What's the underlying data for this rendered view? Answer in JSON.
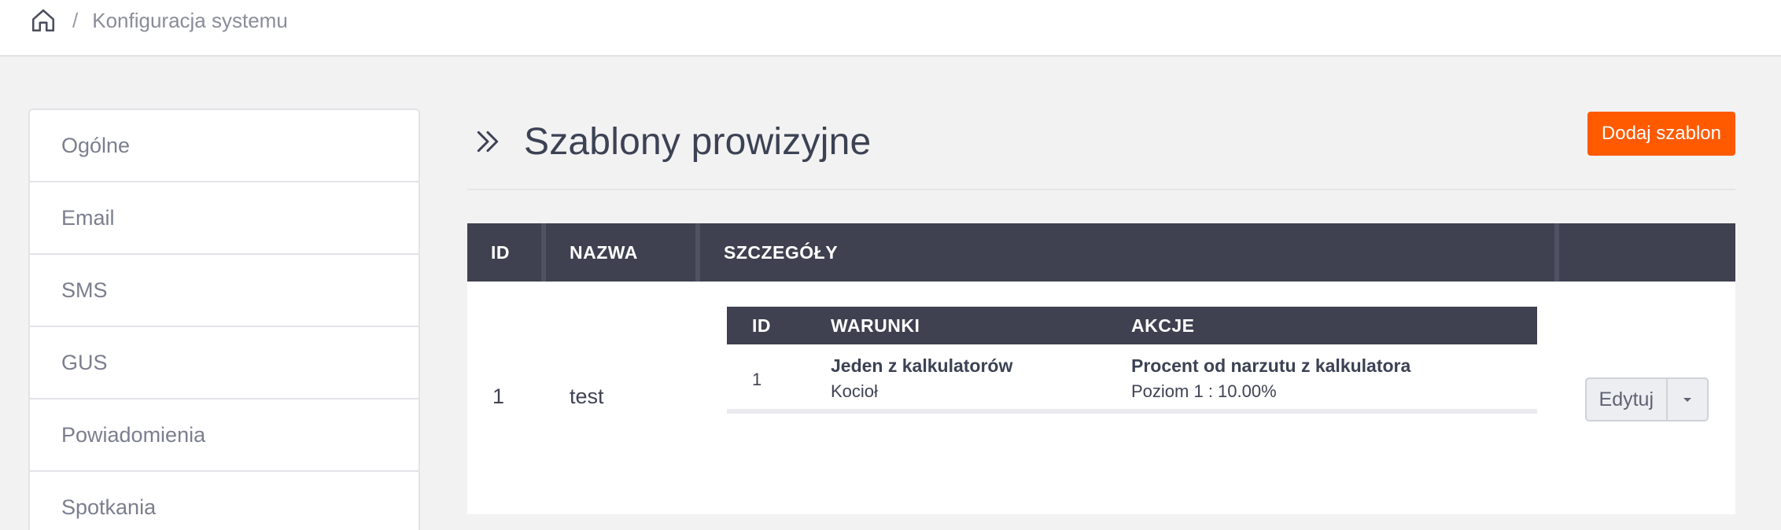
{
  "breadcrumb": {
    "home_icon": "home-icon",
    "separator": "/",
    "current": "Konfiguracja systemu"
  },
  "sidebar": {
    "items": [
      {
        "label": "Ogólne"
      },
      {
        "label": "Email"
      },
      {
        "label": "SMS"
      },
      {
        "label": "GUS"
      },
      {
        "label": "Powiadomienia"
      },
      {
        "label": "Spotkania"
      }
    ]
  },
  "page": {
    "title_icon": "chevrons-right-icon",
    "title": "Szablony prowizyjne",
    "add_button": "Dodaj szablon"
  },
  "table": {
    "columns": [
      "ID",
      "NAZWA",
      "SZCZEGÓŁY",
      ""
    ],
    "rows": [
      {
        "id": "1",
        "name": "test",
        "details": {
          "columns": [
            "ID",
            "WARUNKI",
            "AKCJE"
          ],
          "rows": [
            {
              "id": "1",
              "condition_title": "Jeden z kalkulatorów",
              "condition_value": "Kocioł",
              "action_title": "Procent od narzutu z kalkulatora",
              "action_value": "Poziom 1 : 10.00%"
            }
          ]
        },
        "edit_button": "Edytuj",
        "dropdown_icon": "caret-down-icon"
      }
    ]
  },
  "colors": {
    "accent": "#ff5a00",
    "table_header": "#3f4150",
    "background": "#f2f2f2"
  }
}
